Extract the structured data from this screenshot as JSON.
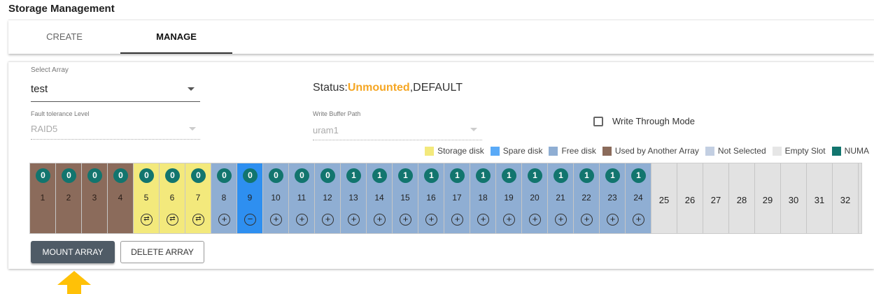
{
  "page_title": "Storage Management",
  "tabs": [
    {
      "label": "CREATE",
      "active": false
    },
    {
      "label": "MANAGE",
      "active": true
    }
  ],
  "select_array": {
    "label": "Select Array",
    "value": "test"
  },
  "status": {
    "prefix": "Status:",
    "state": "Unmounted",
    "suffix": ",DEFAULT"
  },
  "fault_tolerance": {
    "label": "Fault tolerance Level",
    "value": "RAID5"
  },
  "write_buffer": {
    "label": "Write Buffer Path",
    "value": "uram1"
  },
  "write_through": {
    "label": "Write Through Mode",
    "checked": false
  },
  "legend": [
    {
      "label": "Storage disk",
      "color": "#f3e97c"
    },
    {
      "label": "Spare disk",
      "color": "#5aaaf7"
    },
    {
      "label": "Free disk",
      "color": "#8faed3"
    },
    {
      "label": "Used by Another Array",
      "color": "#8b6b5b"
    },
    {
      "label": "Not Selected",
      "color": "#c3cfe2"
    },
    {
      "label": "Empty Slot",
      "color": "#e6e6e6"
    },
    {
      "label": "NUMA",
      "color": "#12756e"
    }
  ],
  "slots": [
    {
      "num": "1",
      "type": "used",
      "numa": "0",
      "action": ""
    },
    {
      "num": "2",
      "type": "used",
      "numa": "0",
      "action": ""
    },
    {
      "num": "3",
      "type": "used",
      "numa": "0",
      "action": ""
    },
    {
      "num": "4",
      "type": "used",
      "numa": "0",
      "action": ""
    },
    {
      "num": "5",
      "type": "storage",
      "numa": "0",
      "action": "swap"
    },
    {
      "num": "6",
      "type": "storage",
      "numa": "0",
      "action": "swap"
    },
    {
      "num": "7",
      "type": "storage",
      "numa": "0",
      "action": "swap"
    },
    {
      "num": "8",
      "type": "free",
      "numa": "0",
      "action": "add"
    },
    {
      "num": "9",
      "type": "spare",
      "numa": "0",
      "action": "remove"
    },
    {
      "num": "10",
      "type": "free",
      "numa": "0",
      "action": "add"
    },
    {
      "num": "11",
      "type": "free",
      "numa": "0",
      "action": "add"
    },
    {
      "num": "12",
      "type": "free",
      "numa": "0",
      "action": "add"
    },
    {
      "num": "13",
      "type": "free",
      "numa": "1",
      "action": "add"
    },
    {
      "num": "14",
      "type": "free",
      "numa": "1",
      "action": "add"
    },
    {
      "num": "15",
      "type": "free",
      "numa": "1",
      "action": "add"
    },
    {
      "num": "16",
      "type": "free",
      "numa": "1",
      "action": "add"
    },
    {
      "num": "17",
      "type": "free",
      "numa": "1",
      "action": "add"
    },
    {
      "num": "18",
      "type": "free",
      "numa": "1",
      "action": "add"
    },
    {
      "num": "19",
      "type": "free",
      "numa": "1",
      "action": "add"
    },
    {
      "num": "20",
      "type": "free",
      "numa": "1",
      "action": "add"
    },
    {
      "num": "21",
      "type": "free",
      "numa": "1",
      "action": "add"
    },
    {
      "num": "22",
      "type": "free",
      "numa": "1",
      "action": "add"
    },
    {
      "num": "23",
      "type": "free",
      "numa": "1",
      "action": "add"
    },
    {
      "num": "24",
      "type": "free",
      "numa": "1",
      "action": "add"
    },
    {
      "num": "25",
      "type": "empty",
      "numa": "",
      "action": ""
    },
    {
      "num": "26",
      "type": "empty",
      "numa": "",
      "action": ""
    },
    {
      "num": "27",
      "type": "empty",
      "numa": "",
      "action": ""
    },
    {
      "num": "28",
      "type": "empty",
      "numa": "",
      "action": ""
    },
    {
      "num": "29",
      "type": "empty",
      "numa": "",
      "action": ""
    },
    {
      "num": "30",
      "type": "empty",
      "numa": "",
      "action": ""
    },
    {
      "num": "31",
      "type": "empty",
      "numa": "",
      "action": ""
    },
    {
      "num": "32",
      "type": "empty",
      "numa": "",
      "action": ""
    }
  ],
  "buttons": {
    "mount": "MOUNT ARRAY",
    "delete": "DELETE ARRAY"
  },
  "arrow_color": "#ffc107"
}
